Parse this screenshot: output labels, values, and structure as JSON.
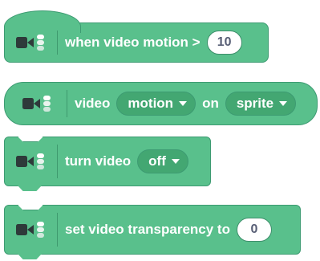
{
  "theme": {
    "block_fill": "#59c08c",
    "block_edge": "#3d9b72",
    "dropdown_fill": "#43a772",
    "separator": "#3f9a6e"
  },
  "blocks": {
    "motion_hat": {
      "label": "when video motion >",
      "value": "10",
      "icon": "video-camera-icon"
    },
    "video_reporter": {
      "label": "video",
      "attribute": "motion",
      "connector": "on",
      "target": "sprite",
      "icon": "video-camera-icon"
    },
    "turn_video": {
      "label": "turn video",
      "state": "off",
      "icon": "video-camera-icon"
    },
    "transparency": {
      "label": "set video transparency to",
      "value": "0",
      "icon": "video-camera-icon"
    }
  }
}
